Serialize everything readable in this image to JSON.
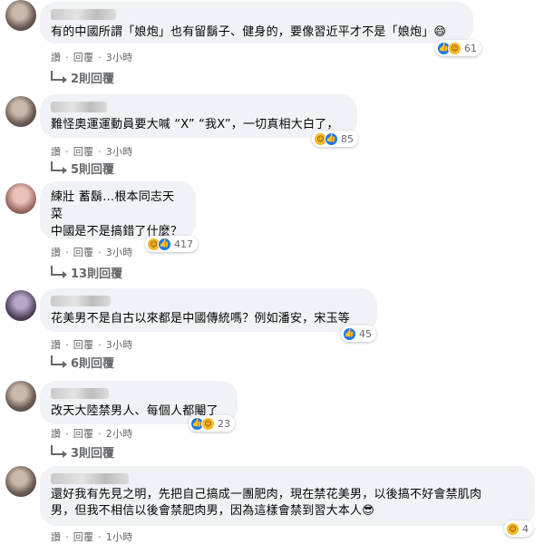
{
  "labels": {
    "like": "讚",
    "reply": "回覆",
    "sep": "·"
  },
  "comments": [
    {
      "text": "有的中國所謂「娘炮」也有留鬍子、健身的，要像習近平才不是「娘炮」😄",
      "reactions": [
        "like",
        "haha"
      ],
      "reaction_count": "61",
      "time": "3小時",
      "replies": "2則回覆"
    },
    {
      "text": "難怪奧運運動員要大喊 “X” “我X”，一切真相大白了，",
      "reactions": [
        "haha",
        "like"
      ],
      "reaction_count": "85",
      "time": "3小時",
      "replies": "5則回覆"
    },
    {
      "text": "練壯 蓄鬍…根本同志天菜\n中國是不是搞錯了什麼？",
      "reactions": [
        "haha",
        "like"
      ],
      "reaction_count": "417",
      "time": "3小時",
      "replies": "13則回覆"
    },
    {
      "text": "花美男不是自古以來都是中國傳統嗎？例如潘安，宋玉等",
      "reactions": [
        "like"
      ],
      "reaction_count": "45",
      "time": "3小時",
      "replies": "6則回覆"
    },
    {
      "text": "改天大陸禁男人、每個人都閹了",
      "reactions": [
        "like",
        "haha"
      ],
      "reaction_count": "23",
      "time": "2小時",
      "replies": "3則回覆"
    },
    {
      "text": "還好我有先見之明，先把自己搞成一團肥肉，現在禁花美男，以後搞不好會禁肌肉\n男，但我不相信以後會禁肥肉男，因為這樣會禁到習大本人😎",
      "reactions": [
        "haha"
      ],
      "reaction_count": "4",
      "time": "1小時",
      "replies": ""
    }
  ]
}
